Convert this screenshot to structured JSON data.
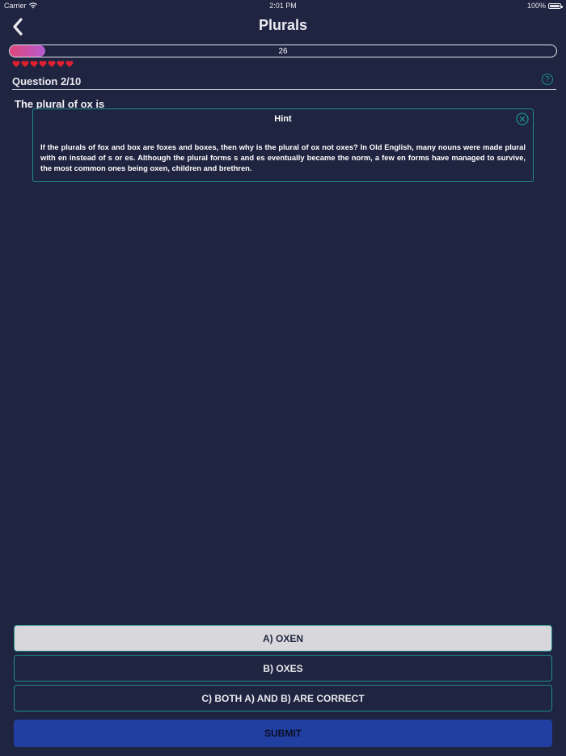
{
  "status_bar": {
    "carrier": "Carrier",
    "time": "2:01 PM",
    "battery": "100%"
  },
  "nav": {
    "title": "Plurals",
    "back_icon": "chevron-left-icon"
  },
  "progress": {
    "value": 26,
    "label": "26",
    "fraction": 0.065
  },
  "lives": {
    "count": 7,
    "icon": "heart-icon",
    "color": "#e0202e"
  },
  "question": {
    "number_label": "Question 2/10",
    "text": "The plural of ox is"
  },
  "hint": {
    "title": "Hint",
    "text": "If the plurals of fox and box are foxes and boxes, then why is the plural of ox not oxes? In Old English, many nouns were made plural with en instead of s or es. Although the plural forms s and es eventually became the norm, a few en forms have managed to survive, the most common ones being oxen, children and brethren."
  },
  "answers": [
    {
      "label": "A) OXEN",
      "selected": true
    },
    {
      "label": "B) OXES",
      "selected": false
    },
    {
      "label": "C) BOTH A) AND B) ARE CORRECT",
      "selected": false
    }
  ],
  "submit_label": "SUBMIT",
  "colors": {
    "background": "#1f2440",
    "accent": "#1f8e8a",
    "submit": "#213fa0",
    "progress_start": "#e0457a",
    "progress_end": "#b45cd0"
  }
}
